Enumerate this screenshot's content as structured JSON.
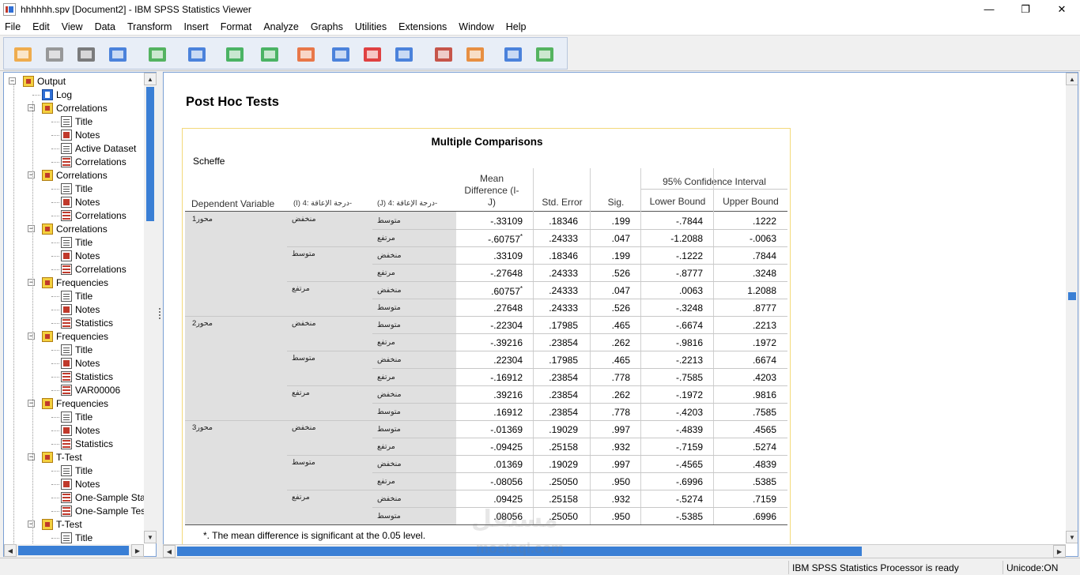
{
  "window": {
    "title": "hhhhhh.spv [Document2] - IBM SPSS Statistics Viewer",
    "minimize": "—",
    "maximize": "❐",
    "close": "✕"
  },
  "menu": [
    "File",
    "Edit",
    "View",
    "Data",
    "Transform",
    "Insert",
    "Format",
    "Analyze",
    "Graphs",
    "Utilities",
    "Extensions",
    "Window",
    "Help"
  ],
  "toolbar": {
    "icons": [
      "open-folder-icon",
      "save-icon",
      "print-icon",
      "print-preview-icon",
      "export-icon",
      "recall-dialog-icon",
      "undo-icon",
      "redo-icon",
      "goto-data-icon",
      "goto-case-icon",
      "goto-variable-icon",
      "variables-icon",
      "designate-window-icon",
      "show-all-icon",
      "custom-dialog-icon",
      "insert-output-icon"
    ]
  },
  "tree": [
    {
      "label": "Output",
      "icon": "book",
      "level": 0,
      "expander": "−"
    },
    {
      "label": "Log",
      "icon": "log",
      "level": 1
    },
    {
      "label": "Correlations",
      "icon": "book",
      "level": 1,
      "expander": "−"
    },
    {
      "label": "Title",
      "icon": "doc",
      "level": 2
    },
    {
      "label": "Notes",
      "icon": "notes",
      "level": 2
    },
    {
      "label": "Active Dataset",
      "icon": "doc",
      "level": 2
    },
    {
      "label": "Correlations",
      "icon": "table",
      "level": 2
    },
    {
      "label": "Correlations",
      "icon": "book",
      "level": 1,
      "expander": "−"
    },
    {
      "label": "Title",
      "icon": "doc",
      "level": 2
    },
    {
      "label": "Notes",
      "icon": "notes",
      "level": 2
    },
    {
      "label": "Correlations",
      "icon": "table",
      "level": 2
    },
    {
      "label": "Correlations",
      "icon": "book",
      "level": 1,
      "expander": "−"
    },
    {
      "label": "Title",
      "icon": "doc",
      "level": 2
    },
    {
      "label": "Notes",
      "icon": "notes",
      "level": 2
    },
    {
      "label": "Correlations",
      "icon": "table",
      "level": 2
    },
    {
      "label": "Frequencies",
      "icon": "book",
      "level": 1,
      "expander": "−"
    },
    {
      "label": "Title",
      "icon": "doc",
      "level": 2
    },
    {
      "label": "Notes",
      "icon": "notes",
      "level": 2
    },
    {
      "label": "Statistics",
      "icon": "table",
      "level": 2
    },
    {
      "label": "Frequencies",
      "icon": "book",
      "level": 1,
      "expander": "−"
    },
    {
      "label": "Title",
      "icon": "doc",
      "level": 2
    },
    {
      "label": "Notes",
      "icon": "notes",
      "level": 2
    },
    {
      "label": "Statistics",
      "icon": "table",
      "level": 2
    },
    {
      "label": "VAR00006",
      "icon": "table",
      "level": 2
    },
    {
      "label": "Frequencies",
      "icon": "book",
      "level": 1,
      "expander": "−"
    },
    {
      "label": "Title",
      "icon": "doc",
      "level": 2
    },
    {
      "label": "Notes",
      "icon": "notes",
      "level": 2
    },
    {
      "label": "Statistics",
      "icon": "table",
      "level": 2
    },
    {
      "label": "T-Test",
      "icon": "book",
      "level": 1,
      "expander": "−"
    },
    {
      "label": "Title",
      "icon": "doc",
      "level": 2
    },
    {
      "label": "Notes",
      "icon": "notes",
      "level": 2
    },
    {
      "label": "One-Sample Statistics",
      "icon": "table",
      "level": 2
    },
    {
      "label": "One-Sample Test",
      "icon": "table",
      "level": 2
    },
    {
      "label": "T-Test",
      "icon": "book",
      "level": 1,
      "expander": "−"
    },
    {
      "label": "Title",
      "icon": "doc",
      "level": 2
    }
  ],
  "content": {
    "section_title": "Post Hoc Tests",
    "table_title": "Multiple Comparisons",
    "table_subtitle": "Scheffe",
    "headers": {
      "dependent_variable": "Dependent Variable",
      "i_col": "(I) درجة الإعاقة :4-",
      "j_col": "(J) درجة الإعاقة :4-",
      "mean_diff_line1": "Mean",
      "mean_diff_line2": "Difference (I-",
      "mean_diff_line3": "J)",
      "std_error": "Std. Error",
      "sig": "Sig.",
      "ci": "95% Confidence Interval",
      "lower": "Lower Bound",
      "upper": "Upper Bound"
    },
    "rows": [
      {
        "dv": "محور1",
        "i": "منخفض",
        "j": "متوسط",
        "md": "-.33109",
        "star": "",
        "se": ".18346",
        "sig": ".199",
        "lb": "-.7844",
        "ub": ".1222"
      },
      {
        "dv": "",
        "i": "",
        "j": "مرتفع",
        "md": "-.60757",
        "star": "*",
        "se": ".24333",
        "sig": ".047",
        "lb": "-1.2088",
        "ub": "-.0063"
      },
      {
        "dv": "",
        "i": "متوسط",
        "j": "منخفض",
        "md": ".33109",
        "star": "",
        "se": ".18346",
        "sig": ".199",
        "lb": "-.1222",
        "ub": ".7844"
      },
      {
        "dv": "",
        "i": "",
        "j": "مرتفع",
        "md": "-.27648",
        "star": "",
        "se": ".24333",
        "sig": ".526",
        "lb": "-.8777",
        "ub": ".3248"
      },
      {
        "dv": "",
        "i": "مرتفع",
        "j": "منخفض",
        "md": ".60757",
        "star": "*",
        "se": ".24333",
        "sig": ".047",
        "lb": ".0063",
        "ub": "1.2088"
      },
      {
        "dv": "",
        "i": "",
        "j": "متوسط",
        "md": ".27648",
        "star": "",
        "se": ".24333",
        "sig": ".526",
        "lb": "-.3248",
        "ub": ".8777"
      },
      {
        "dv": "محور2",
        "i": "منخفض",
        "j": "متوسط",
        "md": "-.22304",
        "star": "",
        "se": ".17985",
        "sig": ".465",
        "lb": "-.6674",
        "ub": ".2213"
      },
      {
        "dv": "",
        "i": "",
        "j": "مرتفع",
        "md": "-.39216",
        "star": "",
        "se": ".23854",
        "sig": ".262",
        "lb": "-.9816",
        "ub": ".1972"
      },
      {
        "dv": "",
        "i": "متوسط",
        "j": "منخفض",
        "md": ".22304",
        "star": "",
        "se": ".17985",
        "sig": ".465",
        "lb": "-.2213",
        "ub": ".6674"
      },
      {
        "dv": "",
        "i": "",
        "j": "مرتفع",
        "md": "-.16912",
        "star": "",
        "se": ".23854",
        "sig": ".778",
        "lb": "-.7585",
        "ub": ".4203"
      },
      {
        "dv": "",
        "i": "مرتفع",
        "j": "منخفض",
        "md": ".39216",
        "star": "",
        "se": ".23854",
        "sig": ".262",
        "lb": "-.1972",
        "ub": ".9816"
      },
      {
        "dv": "",
        "i": "",
        "j": "متوسط",
        "md": ".16912",
        "star": "",
        "se": ".23854",
        "sig": ".778",
        "lb": "-.4203",
        "ub": ".7585"
      },
      {
        "dv": "محور3",
        "i": "منخفض",
        "j": "متوسط",
        "md": "-.01369",
        "star": "",
        "se": ".19029",
        "sig": ".997",
        "lb": "-.4839",
        "ub": ".4565"
      },
      {
        "dv": "",
        "i": "",
        "j": "مرتفع",
        "md": "-.09425",
        "star": "",
        "se": ".25158",
        "sig": ".932",
        "lb": "-.7159",
        "ub": ".5274"
      },
      {
        "dv": "",
        "i": "متوسط",
        "j": "منخفض",
        "md": ".01369",
        "star": "",
        "se": ".19029",
        "sig": ".997",
        "lb": "-.4565",
        "ub": ".4839"
      },
      {
        "dv": "",
        "i": "",
        "j": "مرتفع",
        "md": "-.08056",
        "star": "",
        "se": ".25050",
        "sig": ".950",
        "lb": "-.6996",
        "ub": ".5385"
      },
      {
        "dv": "",
        "i": "مرتفع",
        "j": "منخفض",
        "md": ".09425",
        "star": "",
        "se": ".25158",
        "sig": ".932",
        "lb": "-.5274",
        "ub": ".7159"
      },
      {
        "dv": "",
        "i": "",
        "j": "متوسط",
        "md": ".08056",
        "star": "",
        "se": ".25050",
        "sig": ".950",
        "lb": "-.5385",
        "ub": ".6996"
      }
    ],
    "footnote": "*. The mean difference is significant at the 0.05 level."
  },
  "watermark": {
    "line1": "مستقل",
    "line2": "mostaql.com"
  },
  "status": {
    "processor": "IBM SPSS Statistics Processor is ready",
    "unicode": "Unicode:ON"
  },
  "colors": {
    "accent": "#3a7fd5",
    "frame_border": "#f3d97a",
    "row_shade": "#e0e0e0"
  }
}
